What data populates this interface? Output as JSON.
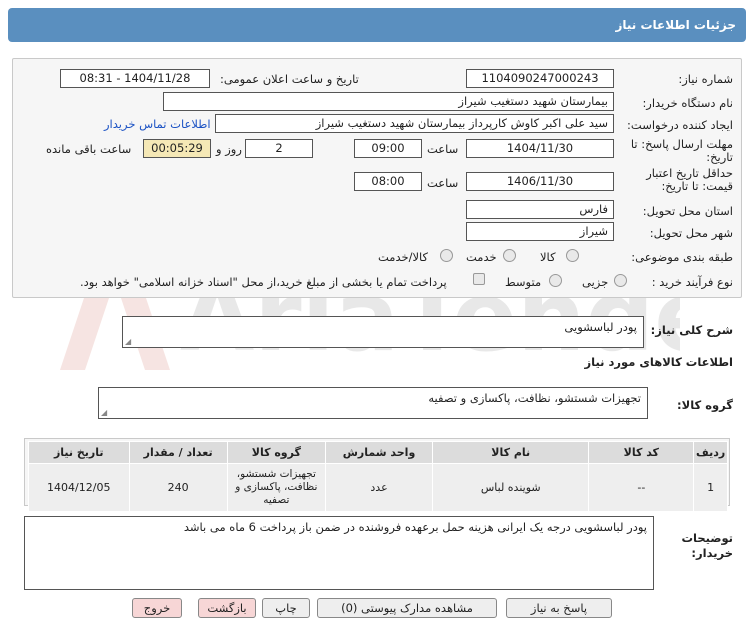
{
  "header": {
    "title": "جزئیات اطلاعات نیاز"
  },
  "form": {
    "need_number_label": "شماره نیاز:",
    "need_number": "1104090247000243",
    "announce_label": "تاریخ و ساعت اعلان عمومی:",
    "announce_value": "1404/11/28 - 08:31",
    "buyer_org_label": "نام دستگاه خریدار:",
    "buyer_org": "بیمارستان شهید دستغیب شیراز",
    "creator_label": "ایجاد کننده درخواست:",
    "creator": "سید علی اکبر کاوش کارپرداز بیمارستان شهید دستغیب شیراز",
    "contact_link": "اطلاعات تماس خریدار",
    "reply_deadline_label": "مهلت ارسال پاسخ: تا تاریخ:",
    "reply_date": "1404/11/30",
    "time_label": "ساعت",
    "reply_time": "09:00",
    "reply_days": "2",
    "days_and_label": "روز و",
    "remaining_time": "00:05:29",
    "remaining_label": "ساعت باقی مانده",
    "price_validity_label": "حداقل تاریخ اعتبار قیمت: تا تاریخ:",
    "price_date": "1406/11/30",
    "price_time": "08:00",
    "province_label": "استان محل تحویل:",
    "province": "فارس",
    "city_label": "شهر محل تحویل:",
    "city": "شیراز",
    "category_label": "طبقه بندی موضوعی:",
    "category_options": [
      "کالا",
      "خدمت",
      "کالا/خدمت"
    ],
    "process_label": "نوع فرآیند خرید :",
    "process_options": [
      "جزیی",
      "متوسط"
    ],
    "payment_note": "پرداخت تمام یا بخشی از مبلغ خرید،از محل \"اسناد خزانه اسلامی\" خواهد بود."
  },
  "summary": {
    "label": "شرح کلی نیاز:",
    "value": "پودر لباسشویی"
  },
  "goods_info": {
    "title": "اطلاعات کالاهای مورد نیاز",
    "group_label": "گروه کالا:",
    "group_value": "تجهیزات شستشو، نظافت، پاکسازی و تصفیه"
  },
  "table": {
    "headers": [
      "ردیف",
      "کد کالا",
      "نام کالا",
      "واحد شمارش",
      "گروه کالا",
      "تعداد / مقدار",
      "تاریخ نیاز"
    ],
    "rows": [
      [
        "1",
        "--",
        "شوینده لباس",
        "عدد",
        "تجهیزات شستشو، نظافت، پاکسازی و تصفیه",
        "240",
        "1404/12/05"
      ]
    ]
  },
  "buyer_notes": {
    "label": "توضیحات خریدار:",
    "value": "پودر لباسشویی درجه یک ایرانی هزینه حمل برعهده فروشنده در ضمن باز پرداخت 6 ماه می باشد"
  },
  "buttons": {
    "reply": "پاسخ به نیاز",
    "attachments": "مشاهده مدارک پیوستی (0)",
    "print": "چاپ",
    "back": "بازگشت",
    "exit": "خروج"
  },
  "watermark": {
    "text": "AriaTender.neT"
  },
  "colors": {
    "titlebar": "#5a8fbf",
    "timer_bg": "#f5e8b6",
    "link": "#1b52c4",
    "pink_button": "#f7d6d6"
  }
}
